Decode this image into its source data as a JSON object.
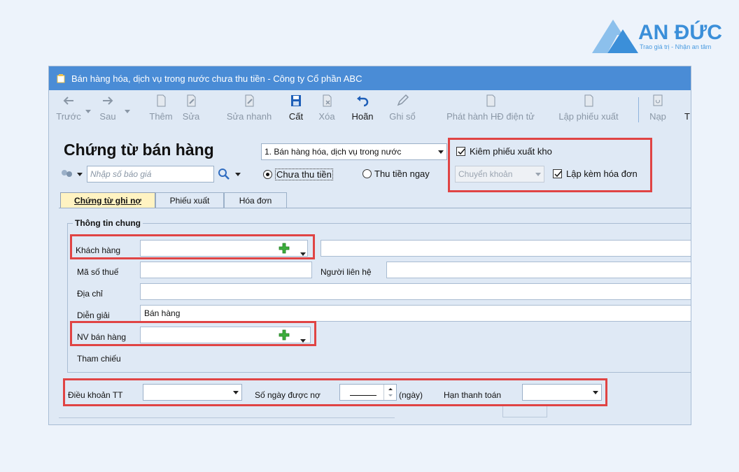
{
  "brand": {
    "name": "AN ĐỨC",
    "tagline": "Trao giá trị - Nhận an tâm",
    "color": "#3b8fd9"
  },
  "window": {
    "title": "Bán hàng hóa, dịch vụ trong nước chưa thu tiền - Công ty Cổ phần ABC"
  },
  "toolbar": {
    "prev": "Trước",
    "next": "Sau",
    "add": "Thêm",
    "edit": "Sửa",
    "quick_edit": "Sửa nhanh",
    "save": "Cất",
    "delete": "Xóa",
    "undo": "Hoãn",
    "post": "Ghi sổ",
    "e_invoice": "Phát hành HĐ điện tử",
    "export_slip": "Lập phiếu xuất",
    "load": "Nạp",
    "more": "T"
  },
  "header": {
    "title": "Chứng từ bán hàng",
    "type_select": "1. Bán hàng hóa, dịch vụ trong nước",
    "quote_placeholder": "Nhập số báo giá",
    "radio_unpaid": "Chưa thu tiền",
    "radio_paid": "Thu tiền ngay",
    "payment_method": "Chuyển khoản",
    "check_export": "Kiêm phiếu xuất kho",
    "check_invoice": "Lập kèm hóa đơn"
  },
  "tabs": [
    {
      "label": "Chứng từ ghi nợ"
    },
    {
      "label": "Phiếu xuất"
    },
    {
      "label": "Hóa đơn"
    }
  ],
  "general": {
    "title": "Thông tin chung",
    "customer_label": "Khách hàng",
    "customer_value": "",
    "customer_name_value": "",
    "tax_label": "Mã số thuế",
    "tax_value": "",
    "contact_label": "Người liên hệ",
    "contact_value": "",
    "address_label": "Địa chỉ",
    "address_value": "",
    "desc_label": "Diễn giải",
    "desc_value": "Bán hàng",
    "staff_label": "NV bán hàng",
    "staff_value": "",
    "ref_label": "Tham chiếu"
  },
  "payment": {
    "terms_label": "Điều khoản TT",
    "terms_value": "",
    "days_label": "Số ngày được nợ",
    "days_value": "",
    "days_unit": "(ngày)",
    "due_label": "Hạn thanh toán",
    "due_value": ""
  },
  "colors": {
    "titlebar": "#4a8cd6",
    "highlight": "#e04444",
    "active_tab": "#fff3c2",
    "add_green": "#3cae3c"
  }
}
